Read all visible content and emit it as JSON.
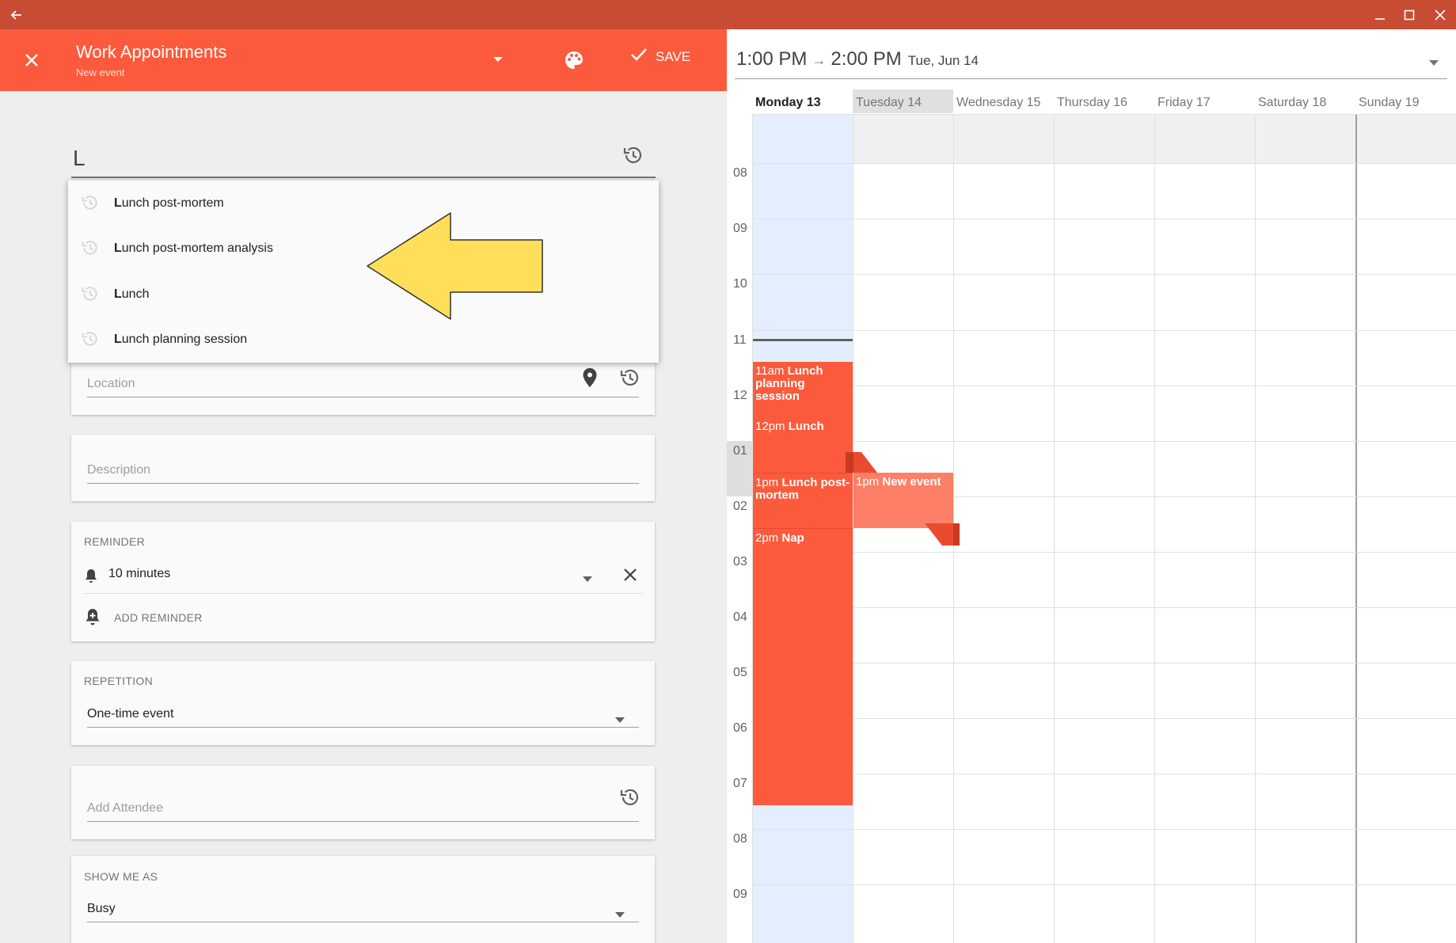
{
  "window": {
    "back_icon": "arrow-left-icon",
    "controls": [
      "minimize-icon",
      "maximize-icon",
      "close-icon"
    ]
  },
  "appbar": {
    "title": "Work Appointments",
    "subtitle": "New event",
    "save_label": "SAVE",
    "accent": "#fc5a3d"
  },
  "form": {
    "title_value": "L",
    "suggestions": [
      {
        "bold": "L",
        "rest": "unch post-mortem"
      },
      {
        "bold": "L",
        "rest": "unch post-mortem analysis"
      },
      {
        "bold": "L",
        "rest": "unch"
      },
      {
        "bold": "L",
        "rest": "unch planning session"
      }
    ],
    "location_placeholder": "Location",
    "description_placeholder": "Description",
    "reminder": {
      "label": "REMINDER",
      "value": "10 minutes",
      "add_label": "ADD REMINDER"
    },
    "repetition": {
      "label": "REPETITION",
      "value": "One-time event"
    },
    "attendee_placeholder": "Add Attendee",
    "show_me_as": {
      "label": "SHOW ME AS",
      "value": "Busy"
    }
  },
  "calendar": {
    "start_time": "1:00 PM",
    "end_time": "2:00 PM",
    "date": "Tue, Jun 14",
    "days": [
      "Monday 13",
      "Tuesday 14",
      "Wednesday 15",
      "Thursday 16",
      "Friday 17",
      "Saturday 18",
      "Sunday 19"
    ],
    "hours": [
      "08",
      "09",
      "10",
      "11",
      "12",
      "01",
      "02",
      "03",
      "04",
      "05",
      "06",
      "07",
      "08",
      "09"
    ],
    "events": [
      {
        "time": "11am",
        "title": "Lunch planning session"
      },
      {
        "time": "12pm",
        "title": "Lunch"
      },
      {
        "time": "1pm",
        "title": "Lunch post-mortem"
      },
      {
        "time": "2pm",
        "title": "Nap"
      },
      {
        "time": "1pm",
        "title": "New event"
      }
    ]
  }
}
